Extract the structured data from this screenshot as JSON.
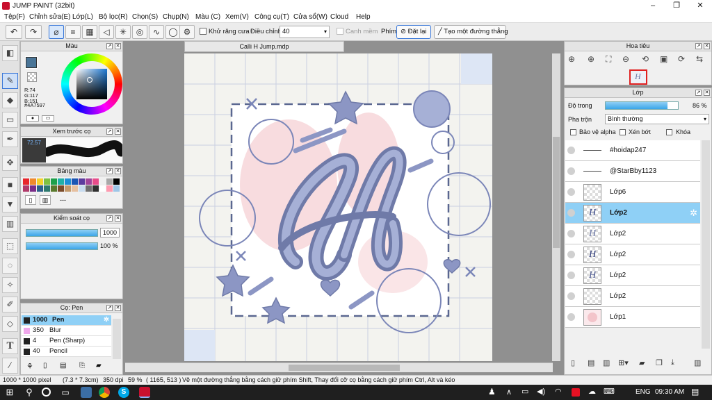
{
  "window": {
    "title": "JUMP PAINT (32bit)",
    "minimize": "–",
    "maximize": "❐",
    "close": "✕"
  },
  "menu": [
    "Tệp(F)",
    "Chỉnh sửa(E)",
    "Lớp(L)",
    "Bộ lọc(R)",
    "Chọn(S)",
    "Chụp(N)",
    "Màu (C)",
    "Xem(V)",
    "Công cụ(T)",
    "Cửa sổ(W)",
    "Cloud",
    "Help"
  ],
  "toolbar": {
    "antialias_label": "Khử răng cưa",
    "adjust_label": "Điều chỉnh",
    "adjust_value": "40",
    "smooth_label": "Canh mềm",
    "key_label": "Phím",
    "reset_label": "Đặt lại",
    "line_label": "Tạo một đường thẳng"
  },
  "color_panel": {
    "title": "Màu",
    "r": "R:74",
    "g": "G:117",
    "b": "B:151",
    "hex": "#4A7597",
    "current": "#4A7597"
  },
  "brush_preview": {
    "title": "Xem trước cọ",
    "value": "72.57"
  },
  "palette": {
    "title": "Bảng màu",
    "extra": "---",
    "colors": [
      "#e8262b",
      "#f08a2c",
      "#f5d12a",
      "#7dc142",
      "#1ea04a",
      "#21b1a7",
      "#1c8fd6",
      "#1a55b4",
      "#5b3b9e",
      "#a0449a",
      "#e84c8a",
      "#f0f0f0",
      "#a8a8a8",
      "#000000",
      "#b03a6a",
      "#7a2d88",
      "#2d5f8a",
      "#2e7a6e",
      "#5a7a2e",
      "#7a4b2a",
      "#c49a6c",
      "#e6c0a0",
      "#c8dcf0",
      "#6f6f6f",
      "#2f2f2f",
      "#ffffff",
      "#ff9ab0",
      "#9ec6e8"
    ]
  },
  "brush_control": {
    "title": "Kiểm soát cọ",
    "size": "1000",
    "opacity": "100 %"
  },
  "brush_list": {
    "title": "Cọ: Pen",
    "items": [
      {
        "size": "1000",
        "name": "Pen",
        "color": "#222222"
      },
      {
        "size": "350",
        "name": "Blur",
        "color": "#f0a8ec"
      },
      {
        "size": "4",
        "name": "Pen (Sharp)",
        "color": "#222222"
      },
      {
        "size": "40",
        "name": "Pencil",
        "color": "#222222"
      }
    ]
  },
  "document": {
    "tab": "Calli H Jump.mdp"
  },
  "navigator": {
    "title": "Hoa tiêu"
  },
  "layers": {
    "title": "Lớp",
    "opacity_label": "Độ trong",
    "opacity_value": "86 %",
    "opacity_fraction": 0.86,
    "blend_label": "Pha trộn",
    "blend_value": "Bình thường",
    "protect_alpha": "Bảo vệ alpha",
    "clipping": "Xén bớt",
    "lock": "Khóa",
    "items": [
      "#hoidap247",
      "@StarBby1123",
      "Lớp6",
      "Lớp2",
      "Lớp2",
      "Lớp2",
      "Lớp2",
      "Lớp2",
      "Lớp1"
    ],
    "selected_index": 3
  },
  "status": {
    "size": "1000 * 1000 pixel",
    "cm": "(7.3 * 7.3cm)",
    "dpi": "350 dpi",
    "zoom": "59 %",
    "coords": "( 1165, 513 )",
    "hint": "Vẽ một đường thẳng bằng cách giữ phím Shift, Thay đổi cỡ cọ bằng cách giữ phím Ctrl, Alt và kéo"
  },
  "taskbar": {
    "lang": "ENG",
    "time": "09:30 AM"
  },
  "canvas_artwork": {
    "letter_color": "#7b86b8",
    "pink_color": "#f4c6cc",
    "dash_color": "#5a6790"
  },
  "icons": {
    "rotate": "⟲",
    "zoom_in": "⊕",
    "zoom_out": "⊖",
    "gear": "✲"
  }
}
